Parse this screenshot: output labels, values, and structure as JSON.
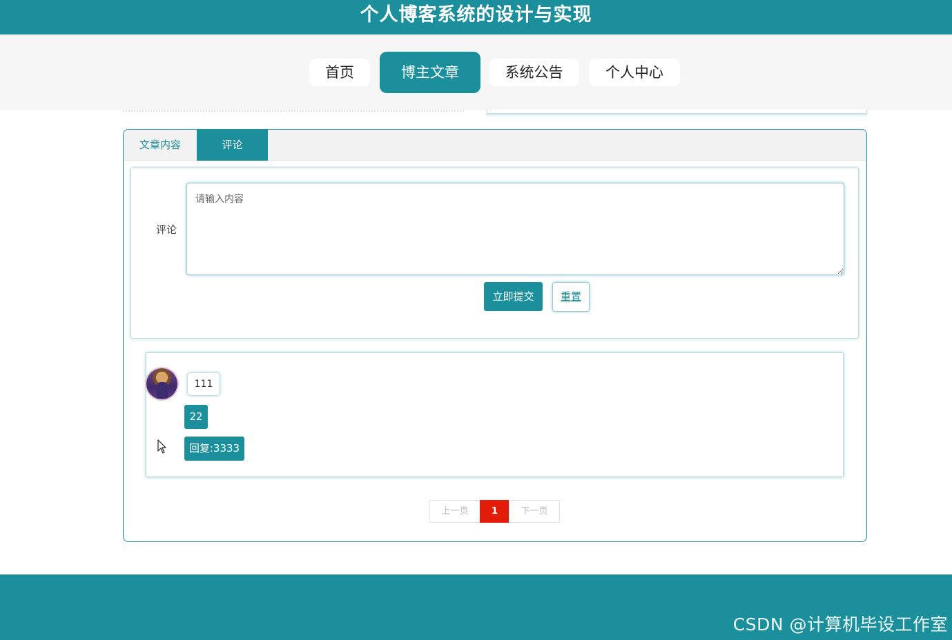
{
  "header": {
    "site_title": "个人博客系统的设计与实现"
  },
  "nav": {
    "items": [
      {
        "label": "首页"
      },
      {
        "label": "博主文章"
      },
      {
        "label": "系统公告"
      },
      {
        "label": "个人中心"
      }
    ],
    "active": "博主文章"
  },
  "tabs": {
    "content_tab": "文章内容",
    "comment_tab": "评论",
    "active": "评论"
  },
  "comment_form": {
    "label": "评论",
    "placeholder": "请输入内容",
    "value": "",
    "submit_label": "立即提交",
    "reset_label": "重置"
  },
  "comments": [
    {
      "username": "111",
      "content": "22",
      "reply": "回复:3333"
    }
  ],
  "pagination": {
    "prev_label": "上一页",
    "current_page": "1",
    "next_label": "下一页"
  },
  "watermark": "CSDN @计算机毕设工作室",
  "colors": {
    "primary": "#1b8f9b",
    "active_page": "#e41d0b",
    "nav_background": "#f6f6f6"
  },
  "icons": {
    "cursor": "mouse-pointer-icon",
    "avatar": "user-avatar"
  }
}
